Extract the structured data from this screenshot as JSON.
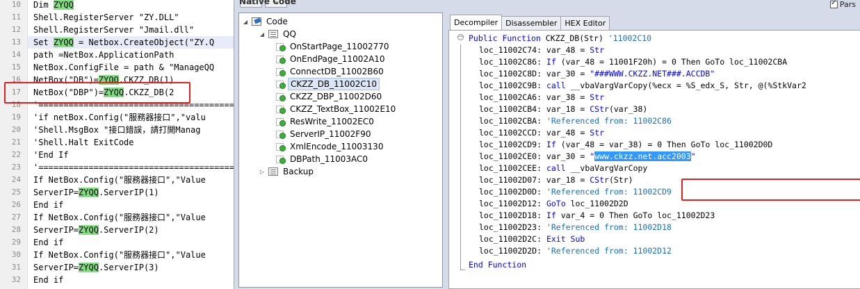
{
  "editor": {
    "lines": [
      {
        "num": "10",
        "pre": "Dim ",
        "hl": "ZYQQ",
        "post": ""
      },
      {
        "num": "11",
        "pre": "Shell.RegisterServer \"ZY.DLL\"",
        "hl": "",
        "post": ""
      },
      {
        "num": "12",
        "pre": "Shell.RegisterServer \"Jmail.dll\"",
        "hl": "",
        "post": ""
      },
      {
        "num": "13",
        "pre": "Set ",
        "hl": "ZYQQ",
        "post": " = Netbox.CreateObject(\"ZY.Q"
      },
      {
        "num": "14",
        "pre": "path =NetBox.ApplicationPath",
        "hl": "",
        "post": ""
      },
      {
        "num": "15",
        "pre": "NetBox.ConfigFile = path & \"ManageQQ",
        "hl": "",
        "post": ""
      },
      {
        "num": "16",
        "pre": "NetBox(\"DB\")=",
        "hl": "ZYQQ",
        "post": ".CKZZ_DB(1)"
      },
      {
        "num": "17",
        "pre": "NetBox(\"DBP\")=",
        "hl": "ZYQQ",
        "post": ".CKZZ_DB(2"
      },
      {
        "num": "18",
        "pre": "'=======================================",
        "hl": "",
        "post": ""
      },
      {
        "num": "19",
        "pre": "'if netBox.Config(\"服務器接口\",\"valu",
        "hl": "",
        "post": ""
      },
      {
        "num": "20",
        "pre": "'Shell.MsgBox \"接口錯誤，請打開Manag",
        "hl": "",
        "post": ""
      },
      {
        "num": "21",
        "pre": "'Shell.Halt ExitCode",
        "hl": "",
        "post": ""
      },
      {
        "num": "22",
        "pre": "'End If",
        "hl": "",
        "post": ""
      },
      {
        "num": "23",
        "pre": "'=======================================",
        "hl": "",
        "post": ""
      },
      {
        "num": "24",
        "pre": "If NetBox.Config(\"服務器接口\",\"Value",
        "hl": "",
        "post": ""
      },
      {
        "num": "25",
        "pre": "ServerIP=",
        "hl": "ZYQQ",
        "post": ".ServerIP(1)"
      },
      {
        "num": "26",
        "pre": "End if",
        "hl": "",
        "post": ""
      },
      {
        "num": "27",
        "pre": "If NetBox.Config(\"服務器接口\",\"Value",
        "hl": "",
        "post": ""
      },
      {
        "num": "28",
        "pre": "ServerIP=",
        "hl": "ZYQQ",
        "post": ".ServerIP(2)"
      },
      {
        "num": "29",
        "pre": "End if",
        "hl": "",
        "post": ""
      },
      {
        "num": "30",
        "pre": "If NetBox.Config(\"服務器接口\",\"Value",
        "hl": "",
        "post": ""
      },
      {
        "num": "31",
        "pre": "ServerIP=",
        "hl": "ZYQQ",
        "post": ".ServerIP(3)"
      },
      {
        "num": "32",
        "pre": "End if",
        "hl": "",
        "post": ""
      }
    ]
  },
  "tool": {
    "title": "Native Code",
    "parse_label": "Pars",
    "nav_back": "<",
    "nav_fwd": ">",
    "tree": {
      "root": "Code",
      "module": "QQ",
      "methods": [
        "OnStartPage_11002770",
        "OnEndPage_11002A10",
        "ConnectDB_11002B60",
        "CKZZ_DB_11002C10",
        "CKZZ_DBP_11002D60",
        "CKZZ_TextBox_11002E10",
        "ResWrite_11002EC0",
        "ServerIP_11002F90",
        "XmlEncode_11003130",
        "DBPath_11003AC0"
      ],
      "selected_index": 3,
      "backup": "Backup"
    },
    "tabs": [
      "Decompiler",
      "Disassembler",
      "HEX Editor"
    ],
    "active_tab": 0,
    "code": {
      "header_kw": "Public Function",
      "header_rest": " CKZZ_DB(Str) ",
      "header_cm": "'11002C10",
      "footer": "End Function",
      "lines": [
        {
          "t": "loc_11002C74: var_48 = ",
          "k": "Str",
          "r": ""
        },
        {
          "t": "loc_11002C86: ",
          "k": "If",
          "r": " (var_48 = 11001F20h) = 0 Then GoTo loc_11002CBA"
        },
        {
          "t": "loc_11002C8D: var_30 = ",
          "s": "\"###WWW.CKZZ.NET###.ACCDB\""
        },
        {
          "t": "loc_11002C9B: ",
          "k": "call",
          "r": " __vbaVargVarCopy(%ecx = %S_edx_S, Str, @(%StkVar2"
        },
        {
          "t": "loc_11002CA6: var_38 = ",
          "k": "Str",
          "r": ""
        },
        {
          "t": "loc_11002CB4: var_18 = ",
          "k": "CStr",
          "r": "(var_38)"
        },
        {
          "t": "loc_11002CBA: ",
          "c": "'Referenced from: 11002C86"
        },
        {
          "t": "loc_11002CCD: var_48 = ",
          "k": "Str",
          "r": ""
        },
        {
          "t": "loc_11002CD9: ",
          "k": "If",
          "r": " (var_48 = var_38) = 0 Then GoTo loc_11002D0D"
        },
        {
          "t": "loc_11002CE0: var_30 = ",
          "s": "\"",
          "sel": "www.ckzz.net.acc2003",
          "s2": "\""
        },
        {
          "t": "loc_11002CEE: ",
          "k": "call",
          "r": " __vbaVargVarCopy"
        },
        {
          "t": "loc_11002D07: var_18 = ",
          "k": "CStr",
          "r": "(Str)"
        },
        {
          "t": "loc_11002D0D: ",
          "c": "'Referenced from: 11002CD9"
        },
        {
          "t": "loc_11002D12: ",
          "k": "GoTo",
          "r": " loc_11002D2D"
        },
        {
          "t": "loc_11002D18: ",
          "k": "If",
          "r": " var_4 = 0 Then GoTo loc_11002D23"
        },
        {
          "t": "loc_11002D23: ",
          "c": "'Referenced from: 11002D18"
        },
        {
          "t": "loc_11002D2C: ",
          "k": "Exit Sub",
          "r": ""
        },
        {
          "t": "loc_11002D2D: ",
          "c": "'Referenced from: 11002D12"
        }
      ]
    }
  }
}
